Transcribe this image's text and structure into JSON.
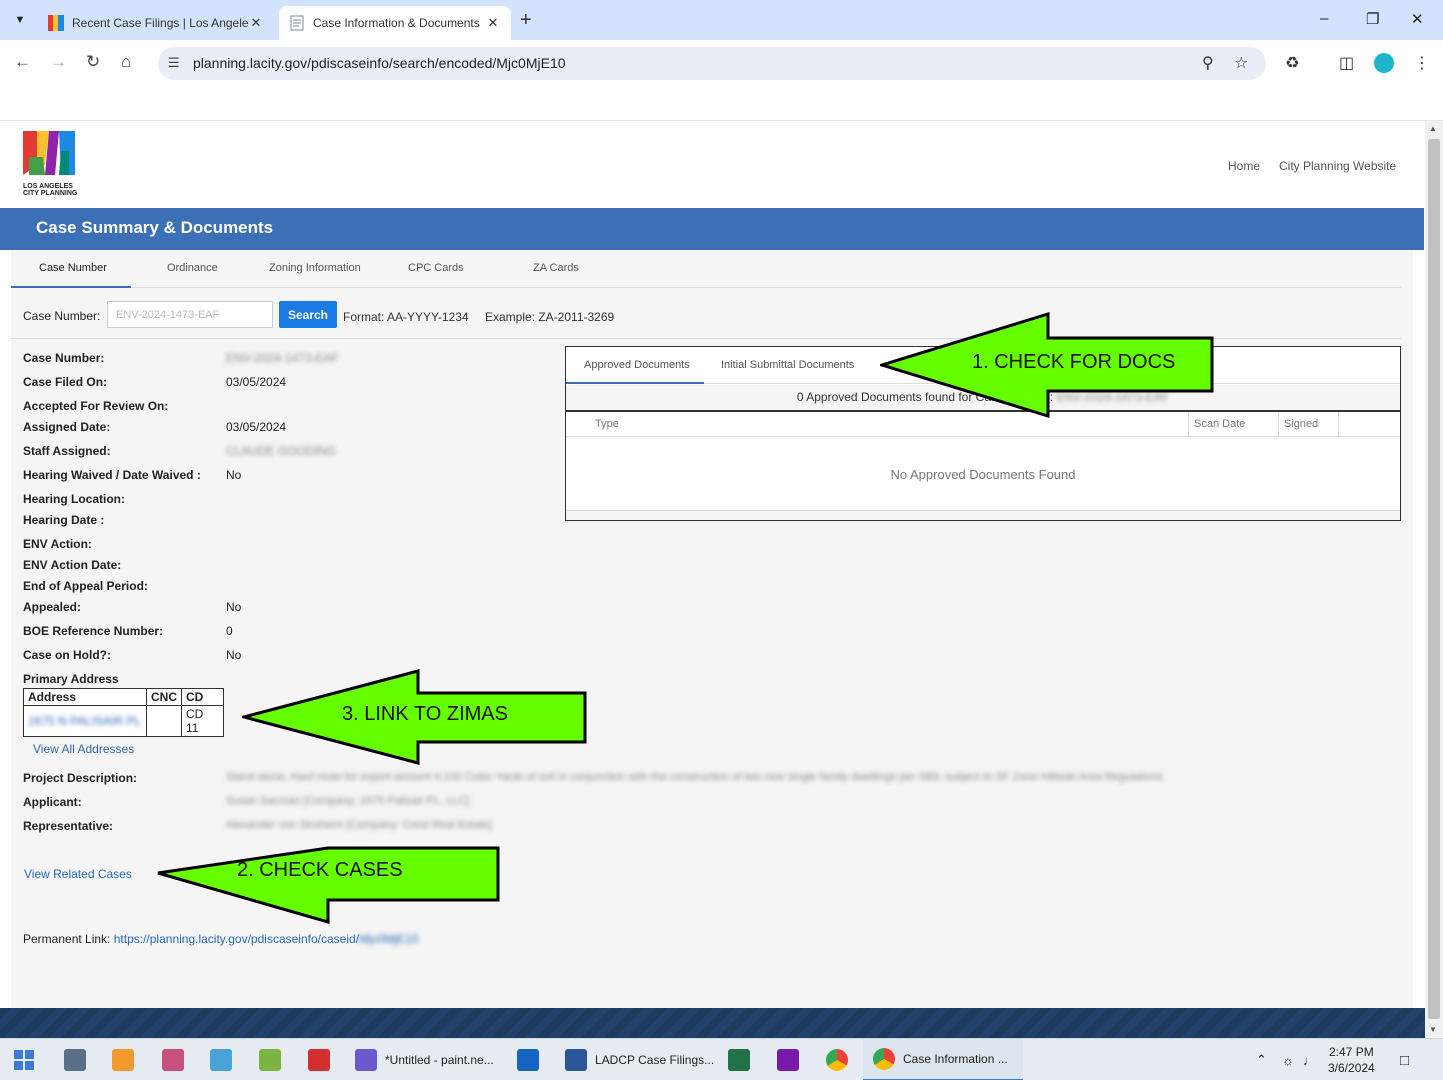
{
  "browser": {
    "tabs": [
      {
        "title": "Recent Case Filings | Los Angeles"
      },
      {
        "title": "Case Information & Documents"
      }
    ],
    "url": "planning.lacity.gov/pdiscaseinfo/search/encoded/Mjc0MjE10"
  },
  "site": {
    "logo_text_1": "LOS ANGELES",
    "logo_text_2": "CITY PLANNING",
    "nav": [
      "Home",
      "City Planning Website"
    ],
    "banner_title": "Case Summary & Documents"
  },
  "page_tabs": [
    "Case Number",
    "Ordinance",
    "Zoning Information",
    "CPC Cards",
    "ZA Cards"
  ],
  "search": {
    "label": "Case Number:",
    "placeholder": "ENV-2024-1473-EAF",
    "button": "Search",
    "format": "Format: AA-YYYY-1234",
    "example": "Example: ZA-2011-3269"
  },
  "case": {
    "labels": {
      "case_number": "Case Number:",
      "filed_on": "Case Filed On:",
      "accepted": "Accepted For Review On:",
      "assigned_date": "Assigned Date:",
      "staff": "Staff Assigned:",
      "hearing_waived": "Hearing Waived / Date Waived :",
      "hearing_location": "Hearing Location:",
      "hearing_date": "Hearing Date :",
      "env_action": "ENV Action:",
      "env_action_date": "ENV Action Date:",
      "appeal_end": "End of Appeal Period:",
      "appealed": "Appealed:",
      "boe_ref": "BOE Reference Number:",
      "on_hold": "Case on Hold?:",
      "primary_address": "Primary Address",
      "project_description": "Project Description:",
      "applicant": "Applicant:",
      "representative": "Representative:",
      "permanent_link": "Permanent Link:"
    },
    "values": {
      "case_number": "ENV-2024-1473-EAF",
      "filed_on": "03/05/2024",
      "assigned_date": "03/05/2024",
      "staff": "CLAUDE GOODING",
      "hearing_waived": "No",
      "appealed": "No",
      "boe_ref": "0",
      "on_hold": "No",
      "project_description": "Stand alone, Haul route for export amount 4,100 Cubic Yards of soil in conjunction with the construction of two new single family dwellings per SB9, subject to SF Zone Hillside Area Regulations.",
      "applicant": "Susan Sacman [Company: 1675 Palisair PL, LLC]",
      "representative": "Alexander von Stroheim [Company: Crest Real Estate]",
      "permanent_link": "https://planning.lacity.gov/pdiscaseinfo/caseid/",
      "permanent_link_tail": "Mjc0MjE10"
    },
    "address_table": {
      "headers": [
        "Address",
        "CNC",
        "CD"
      ],
      "row": [
        "1675 N PALISAIR PL",
        "",
        "CD 11"
      ]
    },
    "view_all_addresses": "View All Addresses",
    "view_related_cases": "View Related Cases"
  },
  "documents": {
    "tabs": [
      "Approved Documents",
      "Initial Submittal Documents"
    ],
    "found_text": "0 Approved Documents found for Case Number: ",
    "found_case": "ENV-2024-1473-EAF",
    "columns": [
      "Type",
      "Scan Date",
      "Signed"
    ],
    "empty_text": "No Approved Documents Found"
  },
  "annotations": {
    "a1": "1. CHECK FOR DOCS",
    "a2": "2. CHECK CASES",
    "a3": "3. LINK TO ZIMAS",
    "color": "#66ff00"
  },
  "taskbar": {
    "items": [
      "*Untitled - paint.ne...",
      "LADCP Case Filings...",
      "Case Information ..."
    ],
    "time": "2:47 PM",
    "date": "3/6/2024"
  },
  "colors": {
    "banner": "#3b6fb6",
    "search_button": "#1a7ae6",
    "link": "#2a6ab4"
  }
}
